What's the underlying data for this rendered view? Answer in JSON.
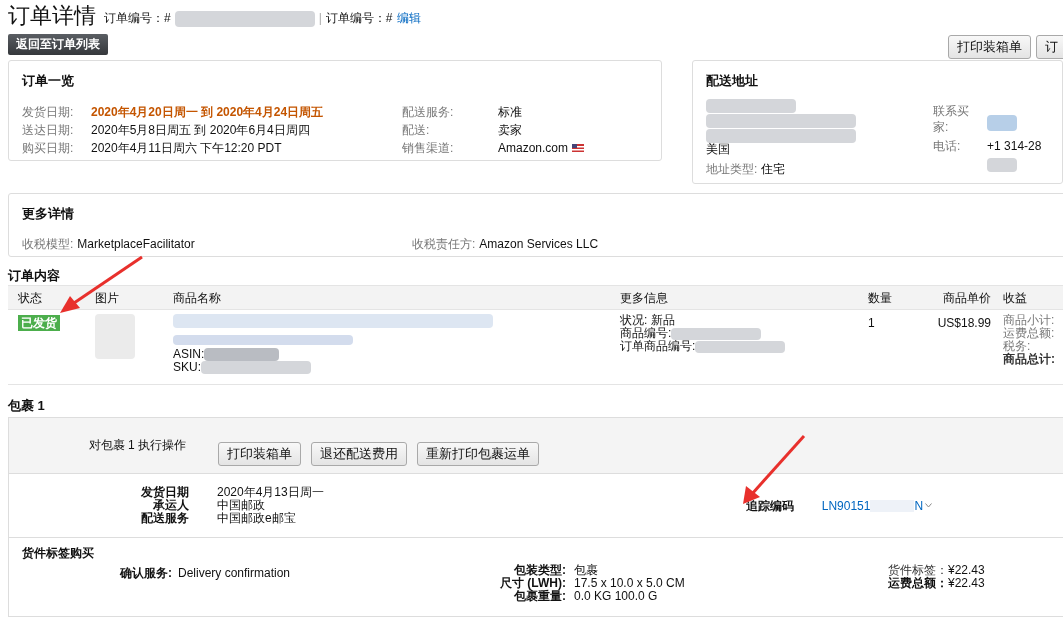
{
  "header": {
    "title": "订单详情",
    "order_label_1": "订单编号：#",
    "separator": "|",
    "order_label_2": "订单编号：#",
    "edit_link": "编辑"
  },
  "back_button": "返回至订单列表",
  "top_buttons": [
    "打印装箱单",
    "订"
  ],
  "overview": {
    "title": "订单一览",
    "rows": [
      {
        "label": "发货日期:",
        "value": "2020年4月20日周一 到 2020年4月24日周五",
        "highlight": true
      },
      {
        "label": "送达日期:",
        "value": "2020年5月8日周五 到 2020年6月4日周四",
        "highlight": false
      },
      {
        "label": "购买日期:",
        "value": "2020年4月11日周六 下午12:20 PDT",
        "highlight": false
      }
    ],
    "right_rows": [
      {
        "label": "配送服务:",
        "value": "标准",
        "flag": false
      },
      {
        "label": "配送:",
        "value": "卖家",
        "flag": false
      },
      {
        "label": "销售渠道:",
        "value": "Amazon.com",
        "flag": true
      }
    ]
  },
  "address": {
    "title": "配送地址",
    "country": "美国",
    "type_label": "地址类型:",
    "type_value": "住宅",
    "contact_label": "联系买家:",
    "phone_label": "电话:",
    "phone": "+1 314-28"
  },
  "more_details": {
    "title": "更多详情",
    "items": [
      {
        "label": "收税模型:",
        "value": "MarketplaceFacilitator"
      },
      {
        "label": "收税责任方:",
        "value": "Amazon Services LLC"
      }
    ]
  },
  "order_contents": {
    "title": "订单内容",
    "columns": [
      "状态",
      "图片",
      "商品名称",
      "更多信息",
      "数量",
      "商品单价",
      "收益"
    ],
    "rows": [
      {
        "status": "已发货",
        "asin_label": "ASIN:",
        "sku_label": "SKU:",
        "info": [
          "状况: 新品",
          "商品编号:",
          "订单商品编号:"
        ],
        "quantity": "1",
        "price": "US$18.99",
        "earnings": [
          {
            "label": "商品小计:",
            "bold": false
          },
          {
            "label": "运费总额:",
            "bold": false
          },
          {
            "label": "税务:",
            "bold": false
          },
          {
            "label": "商品总计:",
            "bold": true
          }
        ]
      }
    ]
  },
  "package": {
    "title": "包裹 1",
    "action_label": "对包裹 1 执行操作",
    "buttons": [
      "打印装箱单",
      "退还配送费用",
      "重新打印包裹运单"
    ],
    "details": [
      {
        "label": "发货日期",
        "value": "2020年4月13日周一"
      },
      {
        "label": "承运人",
        "value": "中国邮政"
      },
      {
        "label": "配送服务",
        "value": "中国邮政e邮宝"
      }
    ],
    "tracking_label": "追踪编码",
    "tracking_prefix": "LN90151",
    "tracking_suffix": "N"
  },
  "label_purchase": {
    "title": "货件标签购买",
    "confirm_label": "确认服务:",
    "confirm_value": "Delivery confirmation",
    "package_rows": [
      {
        "label": "包装类型:",
        "value": "包裹"
      },
      {
        "label": "尺寸 (LWH):",
        "value": "17.5 x 10.0 x 5.0 CM"
      },
      {
        "label": "包裹重量:",
        "value": "0.0 KG 100.0 G"
      }
    ],
    "cost_rows": [
      {
        "label": "货件标签：",
        "value": "¥22.43",
        "bold": false
      },
      {
        "label": "运费总额：",
        "value": "¥22.43",
        "bold": true
      }
    ]
  }
}
